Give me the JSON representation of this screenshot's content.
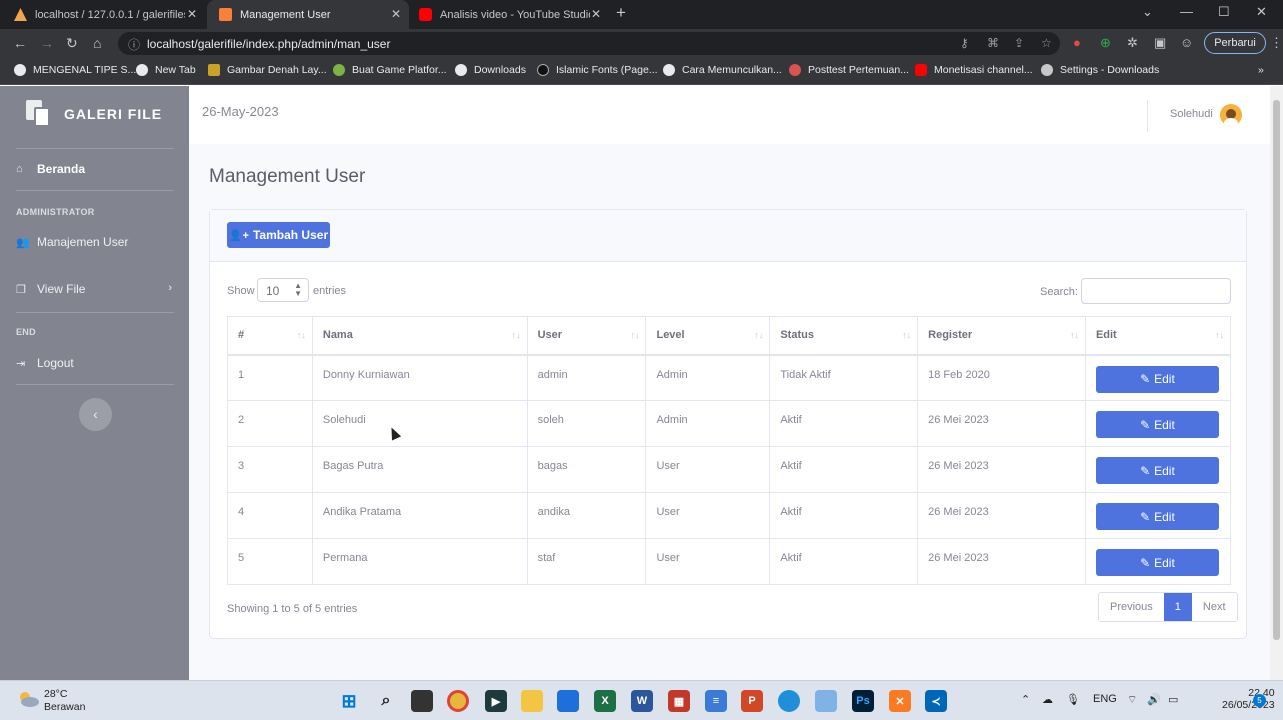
{
  "browser": {
    "tabs": [
      {
        "title": "localhost / 127.0.0.1 / galerifiles_",
        "favicon": "phpmyadmin-icon",
        "active": false
      },
      {
        "title": "Management User",
        "favicon": "xampp-icon",
        "active": true
      },
      {
        "title": "Analisis video - YouTube Studio",
        "favicon": "youtube-icon",
        "active": false
      }
    ],
    "url": "localhost/galerifile/index.php/admin/man_user",
    "update_button": "Perbarui",
    "bookmarks": [
      "MENGENAL TIPE S...",
      "New Tab",
      "Gambar Denah Lay...",
      "Buat Game Platfor...",
      "Downloads",
      "Islamic Fonts (Page...",
      "Cara Memunculkan...",
      "Posttest Pertemuan...",
      "Monetisasi channel...",
      "Settings - Downloads"
    ]
  },
  "sidebar": {
    "brand": "GALERI FILE",
    "items": [
      {
        "label": "Beranda",
        "icon": "home-icon"
      },
      {
        "label": "Manajemen User",
        "icon": "users-icon"
      },
      {
        "label": "View File",
        "icon": "copy-icon"
      },
      {
        "label": "Logout",
        "icon": "sign-out-icon"
      }
    ],
    "headings": {
      "admin": "ADMINISTRATOR",
      "end": "END"
    }
  },
  "topbar": {
    "date": "26-May-2023",
    "username": "Solehudi"
  },
  "page": {
    "title": "Management User",
    "add_button": "Tambah User",
    "show_label": "Show",
    "entries_label": "entries",
    "page_size": "10",
    "search_label": "Search:",
    "columns": [
      "#",
      "Nama",
      "User",
      "Level",
      "Status",
      "Register",
      "Edit"
    ],
    "rows": [
      {
        "no": "1",
        "nama": "Donny Kurniawan",
        "user": "admin",
        "level": "Admin",
        "status": "Tidak Aktif",
        "register": "18 Feb 2020"
      },
      {
        "no": "2",
        "nama": "Solehudi",
        "user": "soleh",
        "level": "Admin",
        "status": "Aktif",
        "register": "26 Mei 2023"
      },
      {
        "no": "3",
        "nama": "Bagas Putra",
        "user": "bagas",
        "level": "User",
        "status": "Aktif",
        "register": "26 Mei 2023"
      },
      {
        "no": "4",
        "nama": "Andika Pratama",
        "user": "andika",
        "level": "User",
        "status": "Aktif",
        "register": "26 Mei 2023"
      },
      {
        "no": "5",
        "nama": "Permana",
        "user": "staf",
        "level": "User",
        "status": "Aktif",
        "register": "26 Mei 2023"
      }
    ],
    "edit_label": "Edit",
    "info": "Showing 1 to 5 of 5 entries",
    "pagination": {
      "prev": "Previous",
      "current": "1",
      "next": "Next"
    }
  },
  "taskbar": {
    "temp": "28°C",
    "weather": "Berawan",
    "lang": "ENG",
    "time": "22.40",
    "date": "26/05/2023",
    "notifications": "5"
  },
  "colors": {
    "primary": "#4e73df",
    "sidebar": "#828590"
  }
}
